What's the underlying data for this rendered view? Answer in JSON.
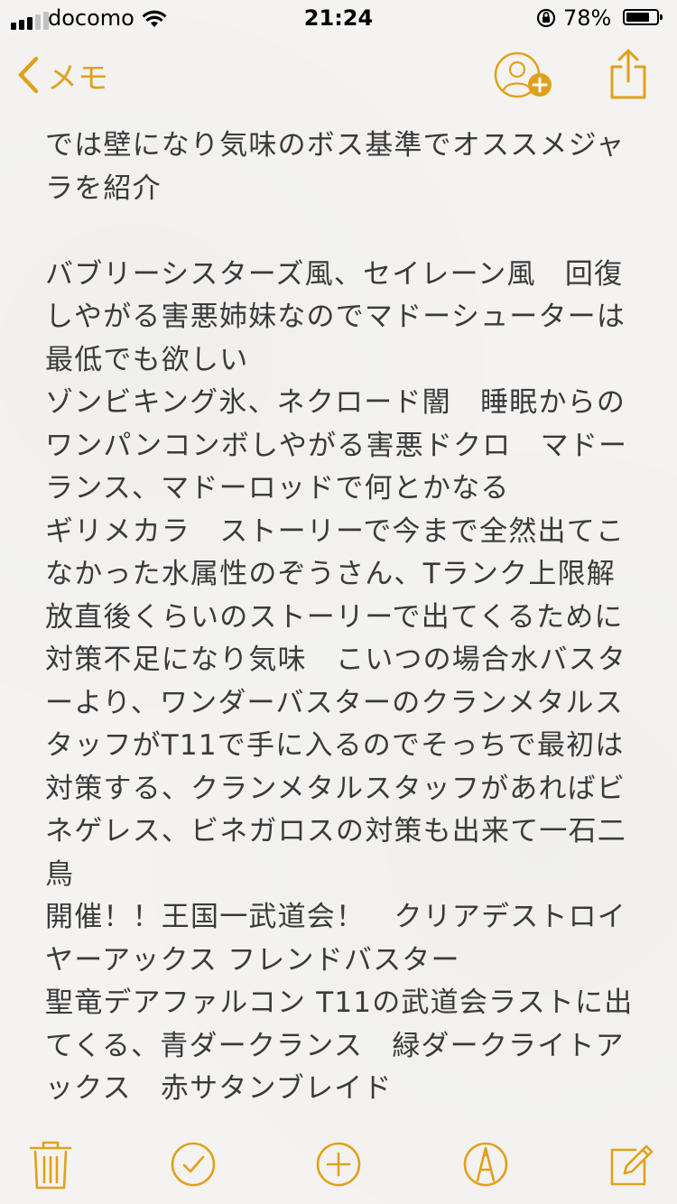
{
  "status_bar": {
    "carrier": "docomo",
    "time": "21:24",
    "battery_percent": "78%",
    "battery_level": 0.78,
    "signal_bars_on": 3,
    "signal_bars_total": 5
  },
  "nav": {
    "back_label": "メモ",
    "back_icon": "chevron-left-icon",
    "add_person_icon": "add-person-icon",
    "share_icon": "share-icon"
  },
  "note": {
    "lines": [
      "では壁になり気味のボス基準でオススメジャ",
      "ラを紹介",
      "",
      "バブリーシスターズ風、セイレーン風　回復",
      "しやがる害悪姉妹なのでマドーシューターは",
      "最低でも欲しい",
      "ゾンビキング氷、ネクロード闇　睡眠からの",
      "ワンパンコンボしやがる害悪ドクロ　マドー",
      "ランス、マドーロッドで何とかなる",
      "ギリメカラ　ストーリーで今まで全然出てこ",
      "なかった水属性のぞうさん、Tランク上限解",
      "放直後くらいのストーリーで出てくるために",
      "対策不足になり気味　こいつの場合水バスタ",
      "ーより、ワンダーバスターのクランメタルス",
      "タッフがT11で手に入るのでそっちで最初は",
      "対策する、クランメタルスタッフがあればビ",
      "ネゲレス、ビネガロスの対策も出来て一石二",
      "鳥",
      "開催！！王国一武道会！　クリアデストロイ",
      "ヤーアックス フレンドバスター",
      "聖竜デアファルコン T11の武道会ラストに出",
      "てくる、青ダークランス　緑ダークライトア",
      "ックス　赤サタンブレイド"
    ]
  },
  "toolbar": {
    "items": [
      "trash-icon",
      "checklist-icon",
      "add-icon",
      "sketch-icon",
      "compose-icon"
    ]
  },
  "colors": {
    "accent": "#e0a11a",
    "text": "#3a3a3a",
    "background": "#f4f3f1"
  }
}
